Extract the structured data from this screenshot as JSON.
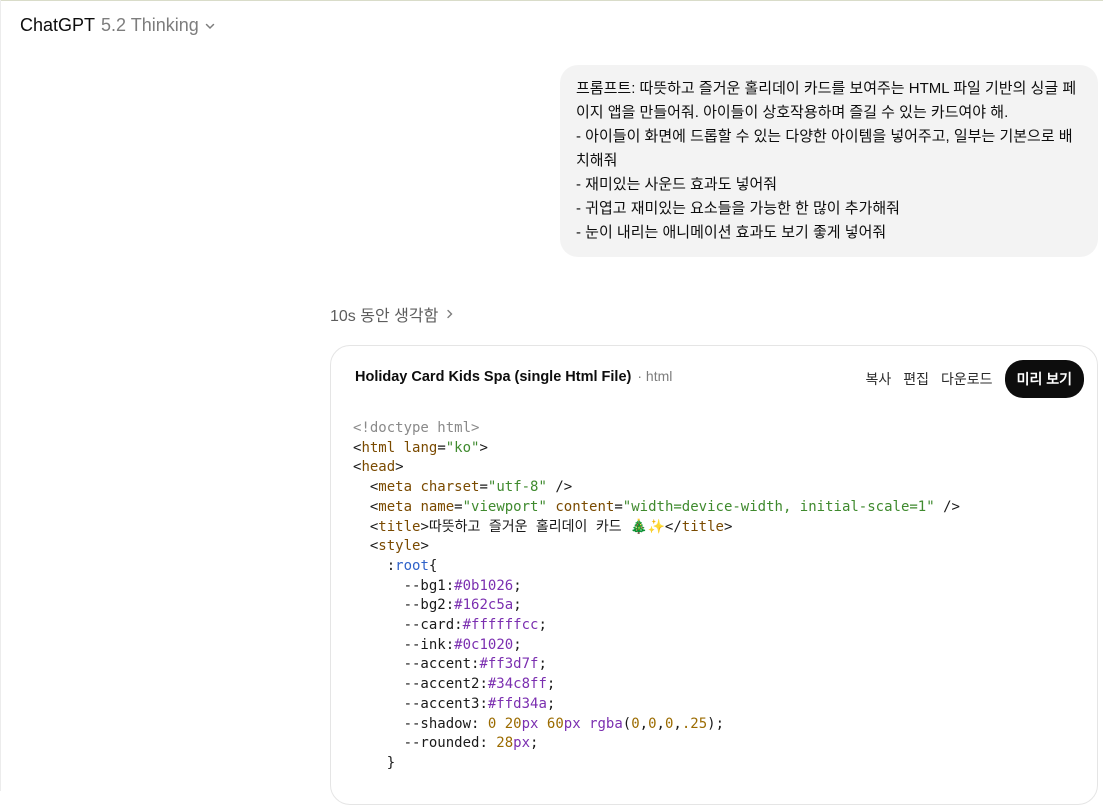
{
  "header": {
    "model_name": "ChatGPT",
    "model_version": "5.2 Thinking"
  },
  "user_message": {
    "lines": [
      "프롬프트: 따뜻하고 즐거운 홀리데이 카드를 보여주는 HTML 파일 기반의 싱글 페",
      "이지 앱을 만들어줘. 아이들이 상호작용하며 즐길 수 있는 카드여야 해.",
      "- 아이들이 화면에 드롭할 수 있는 다양한 아이템을 넣어주고, 일부는 기본으로 배",
      "치해줘",
      "- 재미있는 사운드 효과도 넣어줘",
      "- 귀엽고 재미있는 요소들을 가능한 한 많이 추가해줘",
      "- 눈이 내리는 애니메이션 효과도 보기 좋게 넣어줘"
    ]
  },
  "thinking": {
    "label": "10s 동안 생각함"
  },
  "code_card": {
    "title": "Holiday Card Kids Spa (single Html File)",
    "language": "· html",
    "actions": {
      "copy": "복사",
      "edit": "편집",
      "download": "다운로드",
      "preview": "미리 보기"
    },
    "code": {
      "doctype": "<!doctype html>",
      "html_tag": "html",
      "lang_attr": "lang",
      "lang_val": "\"ko\"",
      "head_tag": "head",
      "meta_tag": "meta",
      "charset_attr": "charset",
      "charset_val": "\"utf-8\"",
      "name_attr": "name",
      "name_val": "\"viewport\"",
      "content_attr": "content",
      "content_val": "\"width=device-width, initial-scale=1\"",
      "title_tag": "title",
      "title_text": "따뜻하고 즐거운 홀리데이 카드 🎄✨",
      "style_tag": "style",
      "root_sel": "root",
      "vars": [
        {
          "name": "--bg1",
          "value": "#0b1026"
        },
        {
          "name": "--bg2",
          "value": "#162c5a"
        },
        {
          "name": "--card",
          "value": "#ffffffcc"
        },
        {
          "name": "--ink",
          "value": "#0c1020"
        },
        {
          "name": "--accent",
          "value": "#ff3d7f"
        },
        {
          "name": "--accent2",
          "value": "#34c8ff"
        },
        {
          "name": "--accent3",
          "value": "#ffd34a"
        }
      ],
      "shadow_name": "--shadow",
      "shadow_parts": [
        "0",
        "20",
        "60",
        "0",
        "0",
        "0",
        ".25"
      ],
      "rounded_name": "--rounded",
      "rounded_num": "28"
    }
  }
}
